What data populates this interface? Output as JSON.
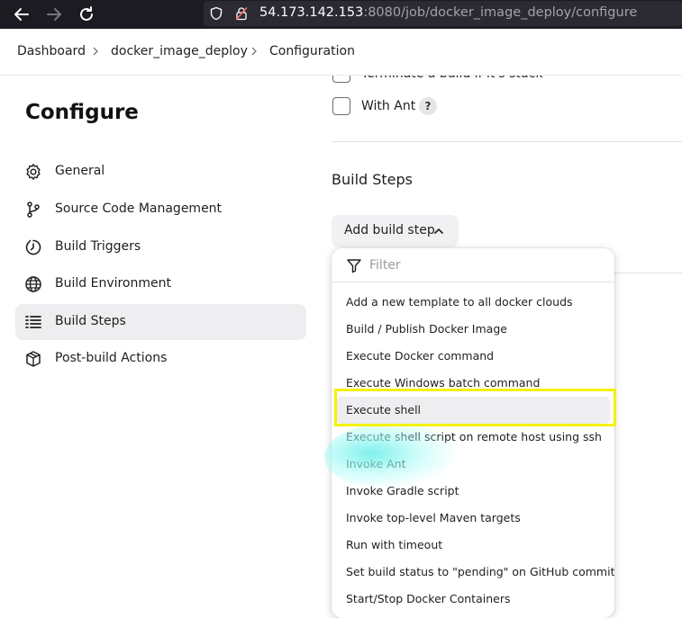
{
  "browser": {
    "url_host": "54.173.142.153",
    "url_rest": ":8080/job/docker_image_deploy/configure"
  },
  "breadcrumb": {
    "items": [
      "Dashboard",
      "docker_image_deploy",
      "Configuration"
    ]
  },
  "sidebar": {
    "title": "Configure",
    "items": [
      {
        "label": "General",
        "icon": "gear-icon"
      },
      {
        "label": "Source Code Management",
        "icon": "branch-icon"
      },
      {
        "label": "Build Triggers",
        "icon": "clock-icon"
      },
      {
        "label": "Build Environment",
        "icon": "globe-icon"
      },
      {
        "label": "Build Steps",
        "icon": "list-icon",
        "active": true
      },
      {
        "label": "Post-build Actions",
        "icon": "box-icon"
      }
    ]
  },
  "main": {
    "checkbox_cut_label": "Terminate a build if it's stuck",
    "checkbox_ant_label": "With Ant",
    "help_label": "?",
    "section_title": "Build Steps",
    "add_build_step_label": "Add build step"
  },
  "dropdown": {
    "filter_placeholder": "Filter",
    "items": [
      "Add a new template to all docker clouds",
      "Build / Publish Docker Image",
      "Execute Docker command",
      "Execute Windows batch command",
      "Execute shell",
      "Execute shell script on remote host using ssh",
      "Invoke Ant",
      "Invoke Gradle script",
      "Invoke top-level Maven targets",
      "Run with timeout",
      "Set build status to \"pending\" on GitHub commit",
      "Start/Stop Docker Containers"
    ],
    "highlighted_item": "Execute shell"
  },
  "colors": {
    "highlight": "#f5f200",
    "active_bg": "#eeeef0",
    "browser_bar": "#1c1b22"
  }
}
